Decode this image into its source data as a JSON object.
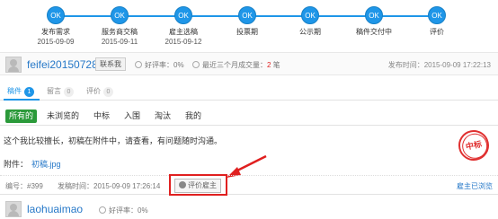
{
  "progress": {
    "steps": [
      {
        "circle": "OK",
        "label": "发布需求",
        "date": "2015-09-09"
      },
      {
        "circle": "OK",
        "label": "服务商交稿",
        "date": "2015-09-11"
      },
      {
        "circle": "OK",
        "label": "雇主选稿",
        "date": "2015-09-12"
      },
      {
        "circle": "OK",
        "label": "投票期",
        "date": ""
      },
      {
        "circle": "OK",
        "label": "公示期",
        "date": ""
      },
      {
        "circle": "OK",
        "label": "稿件交付中",
        "date": ""
      },
      {
        "circle": "OK",
        "label": "评价",
        "date": ""
      }
    ],
    "color": "#1f96e8"
  },
  "header": {
    "username": "feifei20150728",
    "contact_label": "联系我",
    "rating_text": "好评率：0%",
    "volume_prefix": "最近三个月成交量：",
    "volume_count": "2",
    "volume_suffix": " 笔",
    "publish_time": "发布时间：2015-09-09 17:22:13"
  },
  "tabs": [
    {
      "label": "稿件",
      "count": "1"
    },
    {
      "label": "留言",
      "count": "0"
    },
    {
      "label": "评价",
      "count": "0"
    }
  ],
  "filters": [
    "所有的",
    "未浏览的",
    "中标",
    "入围",
    "淘汰",
    "我的"
  ],
  "bid": {
    "text": "这个我比较擅长，初稿在附件中，请查看，有问题随时沟通。",
    "attachment_label": "附件：",
    "attachment_file": "初稿.jpg",
    "stamp": "中标",
    "number": "编号：#399",
    "time": "发稿时间：2015-09-09 17:26:14",
    "rate_label": "评价雇主",
    "selected_note": "雇主已浏览"
  },
  "bidder": {
    "username": "laohuaimao",
    "rating_text": "好评率：0%"
  },
  "colors": {
    "accent": "#1f96e8",
    "active_filter": "#2b9a3a",
    "highlight": "#e02020"
  }
}
